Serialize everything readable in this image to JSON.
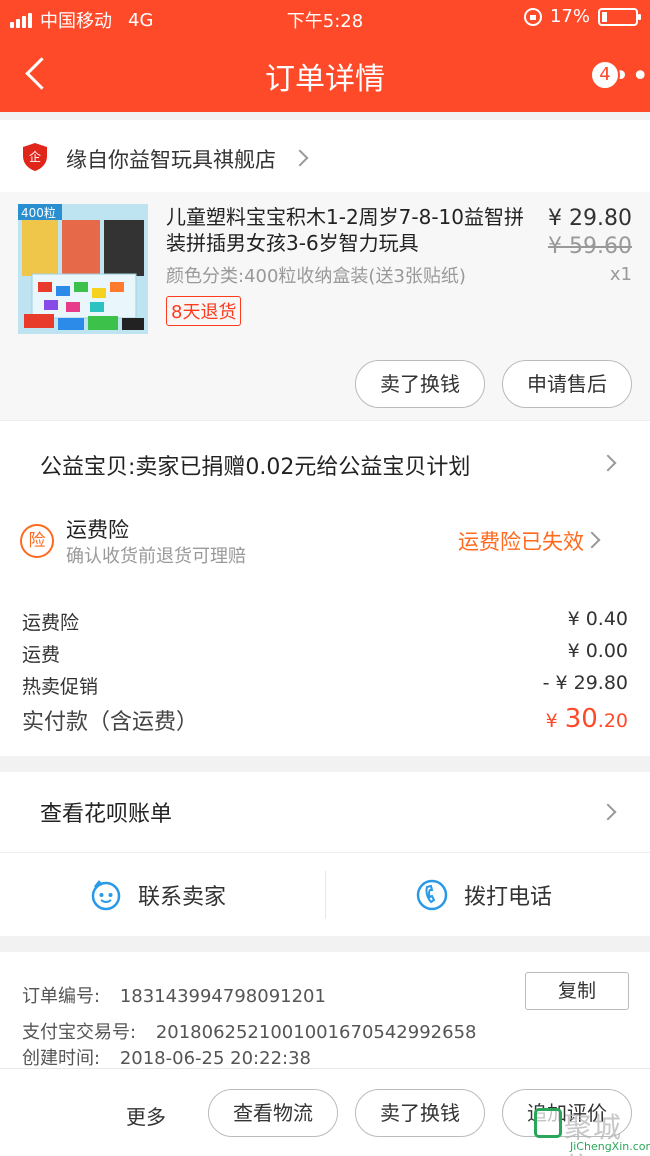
{
  "status_bar": {
    "carrier": "中国移动",
    "network": "4G",
    "time": "下午5:28",
    "battery": "17%",
    "battery_level": 0.17
  },
  "nav": {
    "title": "订单详情",
    "more_icon": "ellipsis-icon",
    "badge": "4"
  },
  "shop": {
    "name": "缘自你益智玩具祺舰店",
    "icon": "shop-shield-icon",
    "icon_char": "企"
  },
  "product": {
    "name": "儿童塑料宝宝积木1-2周岁7-8-10益智拼装拼插男女孩3-6岁智力玩具",
    "spec": "颜色分类:400粒收纳盒装(送3张贴纸)",
    "tag": "8天退货",
    "price": "¥ 29.80",
    "original_price": "¥ 59.60",
    "quantity": "x1",
    "thumb_label": "400粒",
    "actions": [
      "卖了换钱",
      "申请售后"
    ]
  },
  "charity": {
    "text": "公益宝贝:卖家已捐赠0.02元给公益宝贝计划"
  },
  "insurance": {
    "icon_char": "险",
    "title": "运费险",
    "subtitle": "确认收货前退货可理赔",
    "status": "运费险已失效"
  },
  "fees": {
    "rows": [
      {
        "label": "运费险",
        "value": "¥ 0.40"
      },
      {
        "label": "运费",
        "value": "¥ 0.00"
      },
      {
        "label": "热卖促销",
        "value": "- ¥ 29.80"
      }
    ],
    "total_label": "实付款（含运费）",
    "total_currency": "¥",
    "total_int": "30",
    "total_dec": ".20"
  },
  "huabei": {
    "text": "查看花呗账单"
  },
  "contact": {
    "seller": "联系卖家",
    "phone": "拨打电话"
  },
  "order_info": {
    "order_no_label": "订单编号:",
    "order_no": "183143994798091201",
    "copy": "复制",
    "alipay_label": "支付宝交易号:",
    "alipay_no": "2018062521001001670542992658",
    "created_label": "创建时间:",
    "created": "2018-06-25 20:22:38"
  },
  "bottom": {
    "more": "更多",
    "buttons": [
      "查看物流",
      "卖了换钱",
      "追加评价"
    ]
  },
  "watermark": {
    "text": "聚城信",
    "url": "JiChengXin.com"
  },
  "colors": {
    "brand": "#ff4a2a",
    "accent_orange": "#ff6a1f"
  }
}
